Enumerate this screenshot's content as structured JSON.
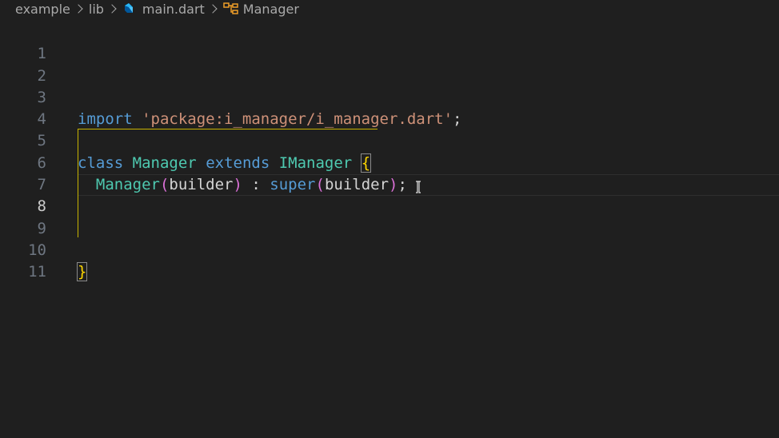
{
  "breadcrumb": {
    "items": [
      "example",
      "lib",
      "main.dart",
      "Manager"
    ]
  },
  "editor": {
    "line_numbers": [
      "1",
      "2",
      "3",
      "4",
      "5",
      "6",
      "7",
      "8",
      "9",
      "10",
      "11"
    ],
    "current_line": "8",
    "lines": {
      "l3": {
        "kw": "import",
        "str": "'package:i_manager/i_manager.dart'",
        "semi": ";"
      },
      "l5": {
        "kw1": "class",
        "name": "Manager",
        "kw2": "extends",
        "base": "IManager",
        "brace": "{"
      },
      "l6": {
        "ctor": "Manager",
        "p1": "(",
        "arg": "builder",
        "p2": ")",
        "colon": " : ",
        "sup": "super",
        "p3": "(",
        "arg2": "builder",
        "p4": ")",
        "semi": ";"
      },
      "l10": {
        "brace": "}"
      }
    }
  },
  "colors": {
    "background": "#1f1f1f",
    "keyword": "#569cd6",
    "string": "#ce9178",
    "class": "#4ec9b0",
    "bracket": "#ffd700"
  },
  "icons": {
    "dart_file": "dart-file-icon",
    "symbol_class": "symbol-class-icon",
    "text_cursor": "text-cursor-icon"
  }
}
